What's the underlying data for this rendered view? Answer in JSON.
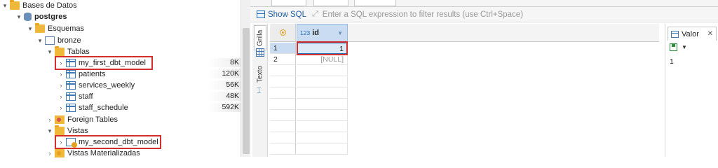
{
  "tree": {
    "bases": "Bases de Datos",
    "postgres": "postgres",
    "esquemas": "Esquemas",
    "bronze": "bronze",
    "tablas": "Tablas",
    "tables": [
      {
        "name": "my_first_dbt_model",
        "size": "8K"
      },
      {
        "name": "patients",
        "size": "120K"
      },
      {
        "name": "services_weekly",
        "size": "56K"
      },
      {
        "name": "staff",
        "size": "48K"
      },
      {
        "name": "staff_schedule",
        "size": "592K"
      }
    ],
    "foreign": "Foreign Tables",
    "vistas": "Vistas",
    "view1": "my_second_dbt_model",
    "mat": "Vistas Materializadas"
  },
  "filter": {
    "show_sql": "Show SQL",
    "placeholder": "Enter a SQL expression to filter results (use Ctrl+Space)"
  },
  "side_tabs": {
    "grid": "Grilla",
    "text": "Texto"
  },
  "results": {
    "column": {
      "type": "123",
      "name": "id"
    },
    "rows": [
      {
        "n": "1",
        "value": "1"
      },
      {
        "n": "2",
        "value": "[NULL]"
      }
    ]
  },
  "valor": {
    "title": "Valor",
    "value": "1"
  },
  "colors": {
    "highlight": "#d32f2f",
    "accent": "#2a6fb5",
    "folder": "#f0b83a"
  }
}
